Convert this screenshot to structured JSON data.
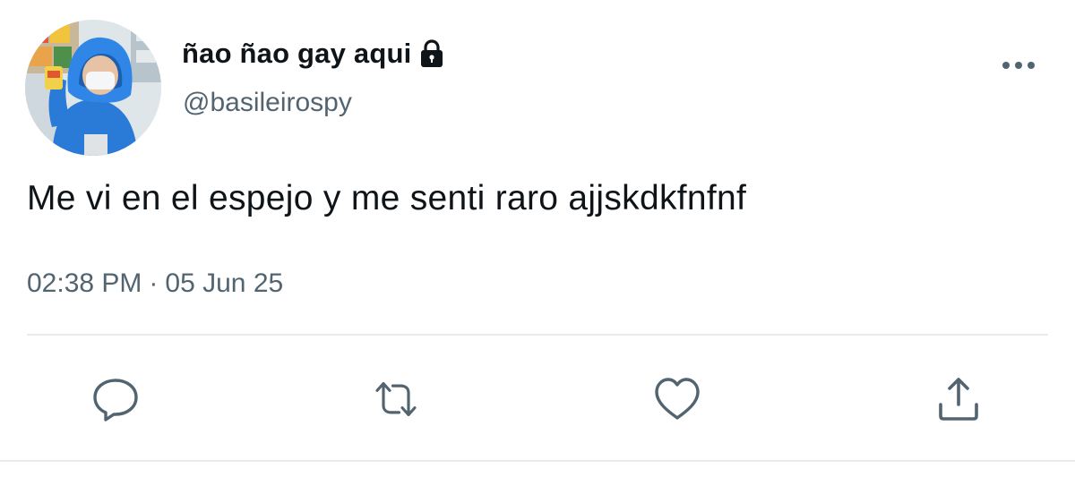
{
  "author": {
    "display_name": "ñao ñao gay aqui",
    "handle": "@basileirospy",
    "protected_icon": "lock-icon",
    "avatar_icon": "avatar-photo"
  },
  "tweet": {
    "text": "Me vi en el espejo y me senti raro ajjskdkfnfnf",
    "time": "02:38 PM",
    "separator": "·",
    "date": "05 Jun 25"
  },
  "menu": {
    "more_icon": "more-dots-icon"
  },
  "actions": [
    {
      "name": "reply",
      "icon": "reply-bubble-icon"
    },
    {
      "name": "retweet",
      "icon": "retweet-icon"
    },
    {
      "name": "like",
      "icon": "heart-icon"
    },
    {
      "name": "share",
      "icon": "share-upload-icon"
    }
  ],
  "colors": {
    "text_primary": "#0f1419",
    "text_secondary": "#536471",
    "divider": "#e6ecf0",
    "avatar_jacket": "#2a7bd8"
  }
}
